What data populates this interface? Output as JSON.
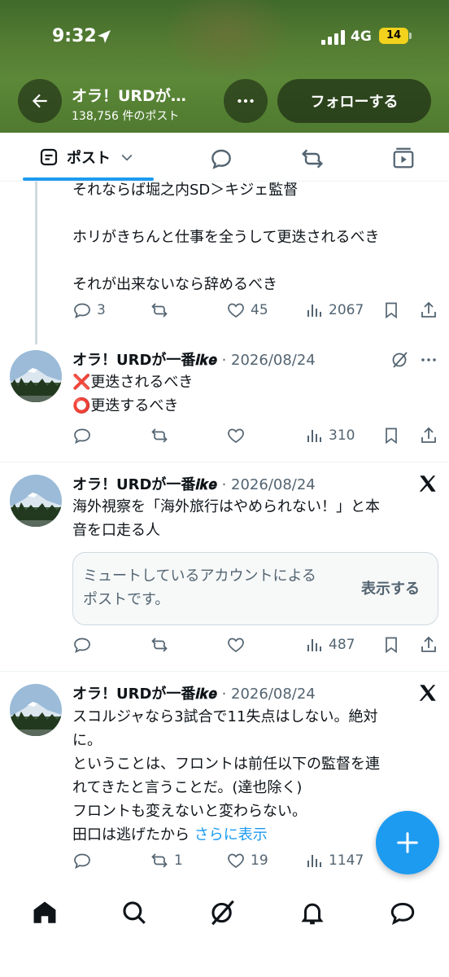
{
  "status_bar": {
    "time": "9:32",
    "network": "4G",
    "battery": "14"
  },
  "header": {
    "title": "オラ！URDが…",
    "post_count": "138,756 件のポスト",
    "follow_label": "フォローする"
  },
  "tabs": {
    "posts_label": "ポスト"
  },
  "tweets": [
    {
      "lines": [
        "それならば堀之内SD＞キジェ監督",
        "",
        "ホリがきちんと仕事を全うして更迭されるべき",
        "",
        "それが出来ないなら辞めるべき"
      ],
      "replies": "3",
      "retweets": "",
      "likes": "45",
      "views": "2067"
    },
    {
      "name": "オラ！URDが一番𝒊𝒌𝒆",
      "date": "· 2026/08/24",
      "line1_emoji": "❌",
      "line1": "更迭されるべき",
      "line2_emoji": "⭕",
      "line2": "更迭するべき",
      "replies": "",
      "retweets": "",
      "likes": "",
      "views": "310"
    },
    {
      "name": "オラ！URDが一番𝒊𝒌𝒆",
      "date": "· 2026/08/24",
      "line1": "海外視察を「海外旅行はやめられない！」と本",
      "line2": "音を口走る人",
      "muted_text": "ミュートしているアカウントによるポストです。",
      "show_label": "表示する",
      "replies": "",
      "retweets": "",
      "likes": "",
      "views": "487"
    },
    {
      "name": "オラ！URDが一番𝒊𝒌𝒆",
      "date": "· 2026/08/24",
      "lines": [
        "スコルジャなら3試合で11失点はしない。絶対",
        "に。",
        "ということは、フロントは前任以下の監督を連",
        "れてきたと言うことだ。(達也除く)",
        "フロントも変えないと変わらない。"
      ],
      "last_line": "田口は逃げたから",
      "show_more": "さらに表示",
      "replies": "",
      "retweets": "1",
      "likes": "19",
      "views": "1147"
    }
  ],
  "colors": {
    "accent": "#1d9bf0",
    "text": "#0f1419",
    "muted": "#536471",
    "header_green": "#557d33"
  },
  "icons": [
    "back-arrow-icon",
    "more-icon",
    "reply-icon",
    "retweet-icon",
    "like-icon",
    "views-icon",
    "bookmark-icon",
    "share-icon",
    "grok-icon",
    "x-logo-icon",
    "home-icon",
    "search-icon",
    "notifications-icon",
    "messages-icon",
    "compose-icon"
  ]
}
